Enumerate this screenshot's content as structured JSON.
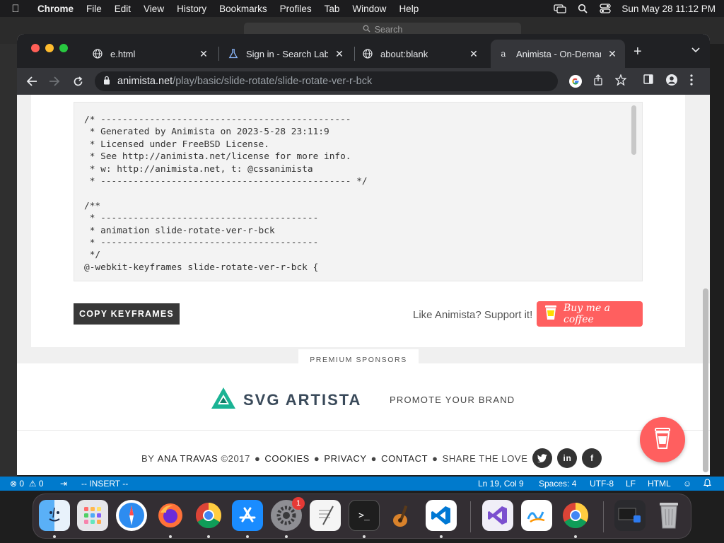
{
  "menubar": {
    "app": "Chrome",
    "items": [
      "File",
      "Edit",
      "View",
      "History",
      "Bookmarks",
      "Profiles",
      "Tab",
      "Window",
      "Help"
    ],
    "clock": "Sun May 28  11:12 PM"
  },
  "vscode": {
    "search_placeholder": "Search",
    "status": {
      "errors": "0",
      "warnings": "0",
      "mode": "-- INSERT --",
      "position": "Ln 19, Col 9",
      "spaces": "Spaces: 4",
      "encoding": "UTF-8",
      "eol": "LF",
      "language": "HTML"
    }
  },
  "chrome": {
    "tabs": [
      {
        "title": "e.html",
        "icon": "globe-icon"
      },
      {
        "title": "Sign in - Search Labs",
        "icon": "flask-icon"
      },
      {
        "title": "about:blank",
        "icon": "globe-icon"
      },
      {
        "title": "Animista - On-Demand",
        "icon": "animista-icon"
      }
    ],
    "url_host": "animista.net",
    "url_path": "/play/basic/slide-rotate/slide-rotate-ver-r-bck"
  },
  "page": {
    "code": "/* ----------------------------------------------\n * Generated by Animista on 2023-5-28 23:11:9\n * Licensed under FreeBSD License.\n * See http://animista.net/license for more info.\n * w: http://animista.net, t: @cssanimista\n * ---------------------------------------------- */\n\n/**\n * ----------------------------------------\n * animation slide-rotate-ver-r-bck\n * ----------------------------------------\n */\n@-webkit-keyframes slide-rotate-ver-r-bck {",
    "copy_button": "COPY KEYFRAMES",
    "support_text": "Like Animista? Support it!",
    "coffee_button": "Buy me a coffee",
    "sponsors_label": "PREMIUM SPONSORS",
    "sponsor_name": "SVG ARTISTA",
    "promote": "PROMOTE YOUR BRAND",
    "footer": {
      "by": "BY",
      "author": "ANA TRAVAS",
      "year": "©2017",
      "cookies": "COOKIES",
      "privacy": "PRIVACY",
      "contact": "CONTACT",
      "share": "SHARE THE LOVE",
      "social": [
        "twitter",
        "linkedin",
        "facebook"
      ]
    }
  },
  "dock": {
    "apps": [
      "Finder",
      "Launchpad",
      "Safari",
      "Firefox",
      "Chrome",
      "App Store",
      "System Settings",
      "TextEdit",
      "Terminal",
      "GarageBand",
      "VS Code",
      "Visual Studio",
      "Freeform",
      "Chrome",
      "Downloads",
      "Trash"
    ],
    "settings_badge": "1"
  },
  "colors": {
    "accent": "#ff5f5f",
    "status_bar": "#007acc",
    "chrome_dark": "#202124"
  }
}
